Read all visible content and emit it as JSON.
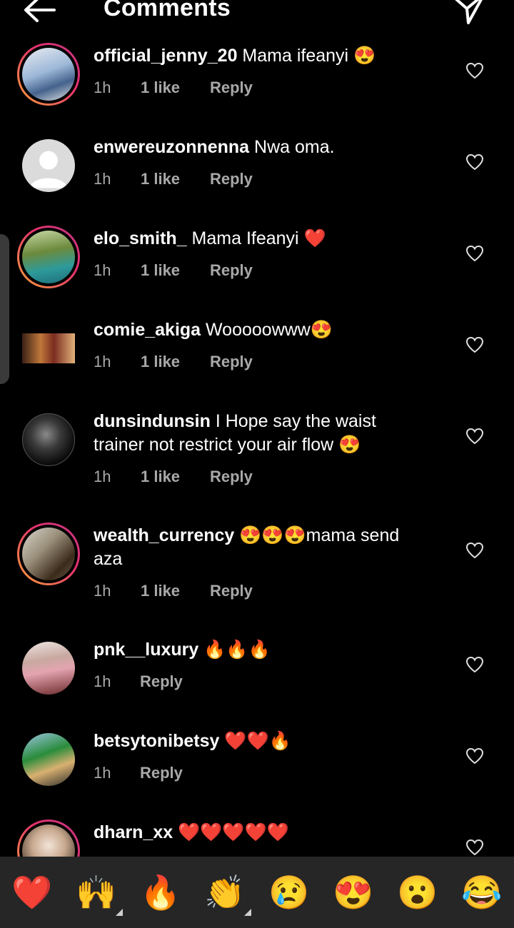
{
  "header": {
    "title": "Comments"
  },
  "comments": [
    {
      "user": "official_jenny_20",
      "text": " Mama ifeanyi 😍",
      "time": "1h",
      "likes": "1 like",
      "reply": "Reply"
    },
    {
      "user": "enwereuzonnenna",
      "text": " Nwa oma.",
      "time": "1h",
      "likes": "1 like",
      "reply": "Reply"
    },
    {
      "user": "elo_smith_",
      "text": " Mama Ifeanyi ❤️",
      "time": "1h",
      "likes": "1 like",
      "reply": "Reply"
    },
    {
      "user": "comie_akiga",
      "text": " Wooooowww😍",
      "time": "1h",
      "likes": "1 like",
      "reply": "Reply"
    },
    {
      "user": "dunsindunsin",
      "text": " I Hope say the waist trainer not restrict your air flow 😍",
      "time": "1h",
      "likes": "1 like",
      "reply": "Reply"
    },
    {
      "user": "wealth_currency",
      "text": " 😍😍😍mama send aza",
      "time": "1h",
      "likes": "1 like",
      "reply": "Reply"
    },
    {
      "user": "pnk__luxury",
      "text": " 🔥🔥🔥",
      "time": "1h",
      "reply": "Reply"
    },
    {
      "user": "betsytonibetsy",
      "text": " ❤️❤️🔥",
      "time": "1h",
      "reply": "Reply"
    },
    {
      "user": "dharn_xx",
      "text": " ❤️❤️❤️❤️❤️"
    }
  ],
  "reactions": [
    "❤️",
    "🙌",
    "🔥",
    "👏",
    "😢",
    "😍",
    "😮",
    "😂"
  ],
  "colors": {
    "background": "#000000",
    "meta_text": "#a8a8a8",
    "emoji_bar": "#262626",
    "story_ring": "#e5316d"
  }
}
